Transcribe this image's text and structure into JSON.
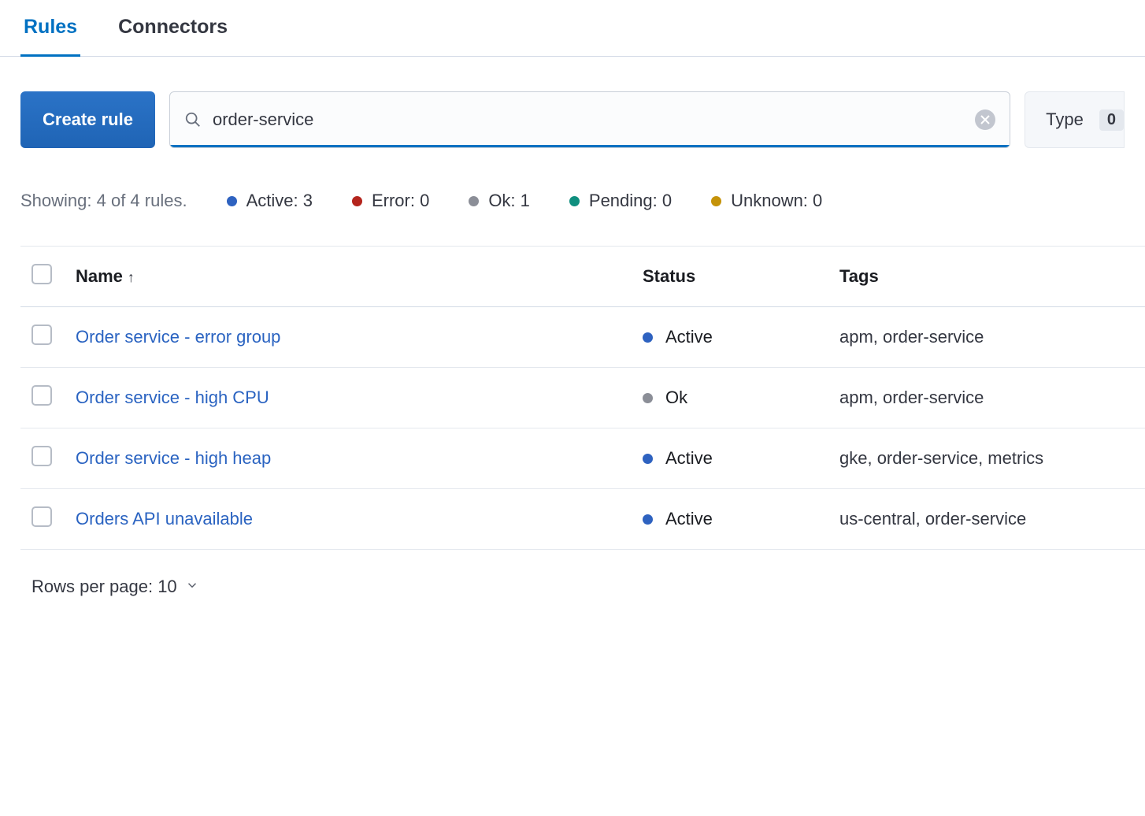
{
  "tabs": [
    {
      "label": "Rules",
      "active": true
    },
    {
      "label": "Connectors",
      "active": false
    }
  ],
  "toolbar": {
    "create_label": "Create rule",
    "search_value": "order-service",
    "type_filter_label": "Type",
    "type_filter_count": "0"
  },
  "summary": {
    "showing_text": "Showing: 4 of 4 rules.",
    "stats": {
      "active": {
        "label": "Active: 3"
      },
      "error": {
        "label": "Error: 0"
      },
      "ok": {
        "label": "Ok: 1"
      },
      "pending": {
        "label": "Pending: 0"
      },
      "unknown": {
        "label": "Unknown: 0"
      }
    }
  },
  "table": {
    "headers": {
      "name": "Name",
      "status": "Status",
      "tags": "Tags"
    },
    "rows": [
      {
        "name": "Order service - error group",
        "status": "Active",
        "status_kind": "active",
        "tags": "apm, order-service"
      },
      {
        "name": "Order service - high CPU",
        "status": "Ok",
        "status_kind": "ok",
        "tags": "apm, order-service"
      },
      {
        "name": "Order service - high heap",
        "status": "Active",
        "status_kind": "active",
        "tags": "gke, order-service, metrics"
      },
      {
        "name": "Orders API unavailable",
        "status": "Active",
        "status_kind": "active",
        "tags": "us-central, order-service"
      }
    ]
  },
  "pager": {
    "label": "Rows per page: 10"
  },
  "colors": {
    "active": "#2e62c0",
    "error": "#b4251d",
    "ok": "#8b8e97",
    "pending": "#0f8f7f",
    "unknown": "#c59309"
  }
}
